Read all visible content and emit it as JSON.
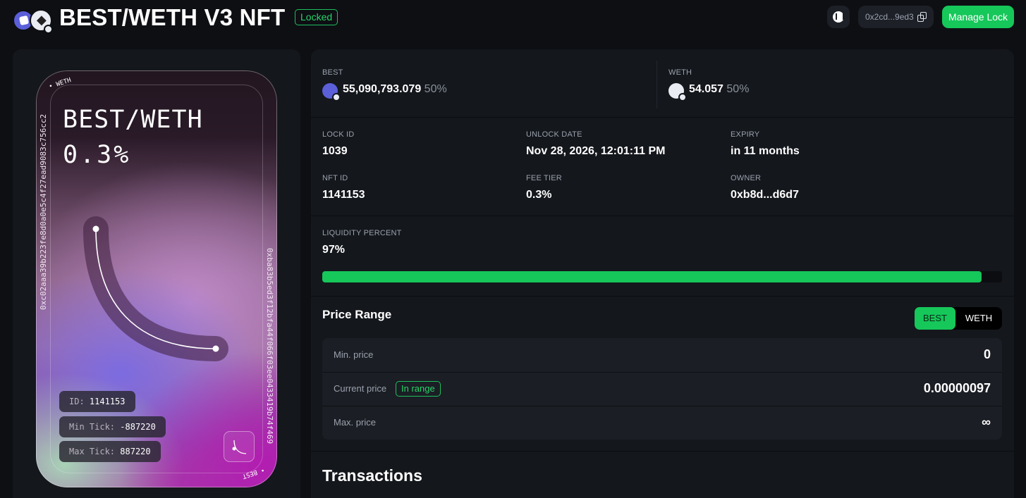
{
  "header": {
    "title": "BEST/WETH V3 NFT",
    "status_badge": "Locked",
    "wallet_address": "0x2cd...9ed3",
    "manage_button": "Manage Lock",
    "icons": [
      "best-token-icon",
      "weth-token-icon",
      "explorer-icon",
      "copy-icon"
    ]
  },
  "nft": {
    "title": "BEST/WETH",
    "fee": "0.3%",
    "corner_top": "• WETH",
    "corner_bottom": "• BEST",
    "side_left_address": "0xc02aaa39b223fe8d0a0e5c4f27ead9083c756cc2",
    "side_right_address": "0xba83b5ed3f12bfa44f066f03ee0433419b74f469",
    "pills": [
      {
        "key": "ID:",
        "value": "1141153"
      },
      {
        "key": "Min Tick:",
        "value": "-887220"
      },
      {
        "key": "Max Tick:",
        "value": "887220"
      }
    ]
  },
  "tokens": [
    {
      "symbol": "BEST",
      "amount": "55,090,793.079",
      "percent": "50%"
    },
    {
      "symbol": "WETH",
      "amount": "54.057",
      "percent": "50%"
    }
  ],
  "details": {
    "lock_id_label": "LOCK ID",
    "lock_id": "1039",
    "unlock_date_label": "UNLOCK DATE",
    "unlock_date": "Nov 28, 2026, 12:01:11 PM",
    "expiry_label": "EXPIRY",
    "expiry": "in 11 months",
    "nft_id_label": "NFT ID",
    "nft_id": "1141153",
    "fee_tier_label": "FEE TIER",
    "fee_tier": "0.3%",
    "owner_label": "OWNER",
    "owner": "0xb8d...d6d7"
  },
  "liquidity": {
    "label": "LIQUIDITY PERCENT",
    "value_text": "97%",
    "fraction": 0.97
  },
  "price_range": {
    "title": "Price Range",
    "toggle_options": [
      "BEST",
      "WETH"
    ],
    "selected": "BEST",
    "min_label": "Min. price",
    "min_value": "0",
    "current_label": "Current price",
    "current_badge": "In range",
    "current_value": "0.00000097",
    "max_label": "Max. price",
    "max_value": "∞"
  },
  "transactions": {
    "title": "Transactions"
  },
  "colors": {
    "accent": "#16c75a",
    "background": "#0d0f13",
    "panel": "#14171c"
  }
}
